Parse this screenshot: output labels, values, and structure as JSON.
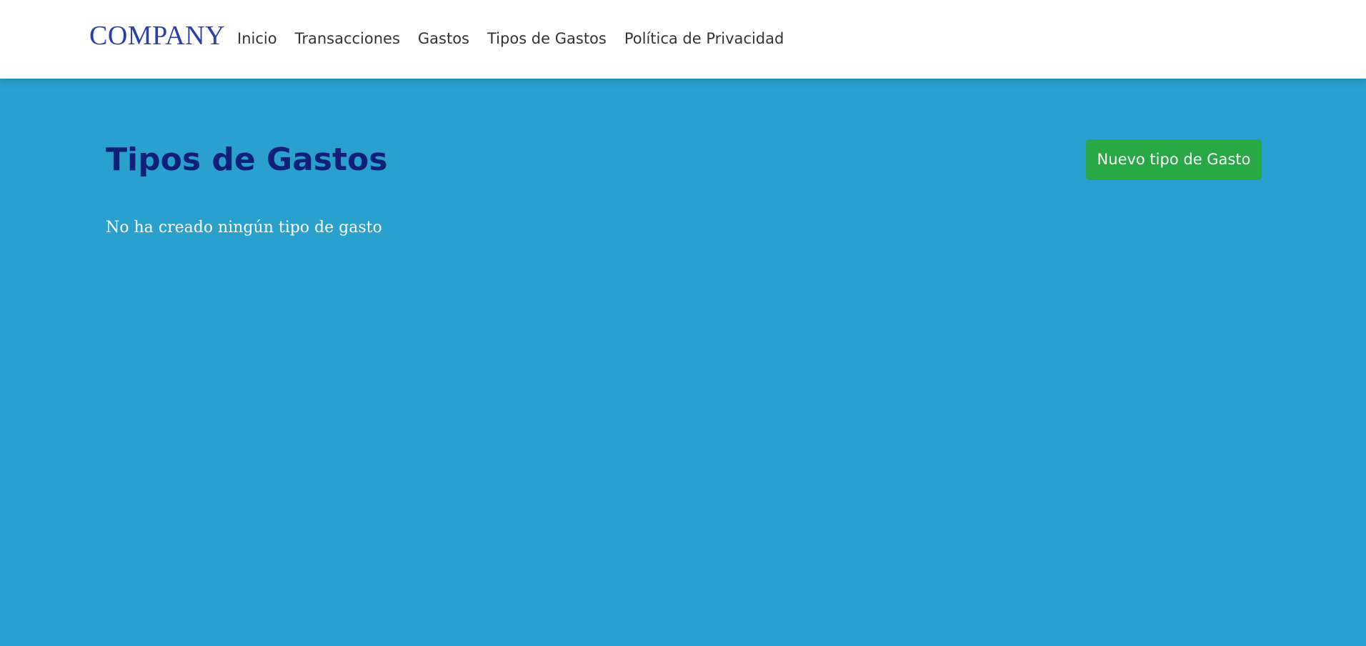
{
  "brand": "COMPANY",
  "nav": {
    "items": [
      {
        "label": "Inicio"
      },
      {
        "label": "Transacciones"
      },
      {
        "label": "Gastos"
      },
      {
        "label": "Tipos de Gastos"
      },
      {
        "label": "Política de Privacidad"
      }
    ]
  },
  "main": {
    "title": "Tipos de Gastos",
    "new_button_label": "Nuevo tipo de Gasto",
    "empty_message": "No ha creado ningún tipo de gasto"
  },
  "colors": {
    "background": "#2aa0cf",
    "brand": "#2a3fa8",
    "title": "#0f1f7a",
    "button": "#28a745"
  }
}
